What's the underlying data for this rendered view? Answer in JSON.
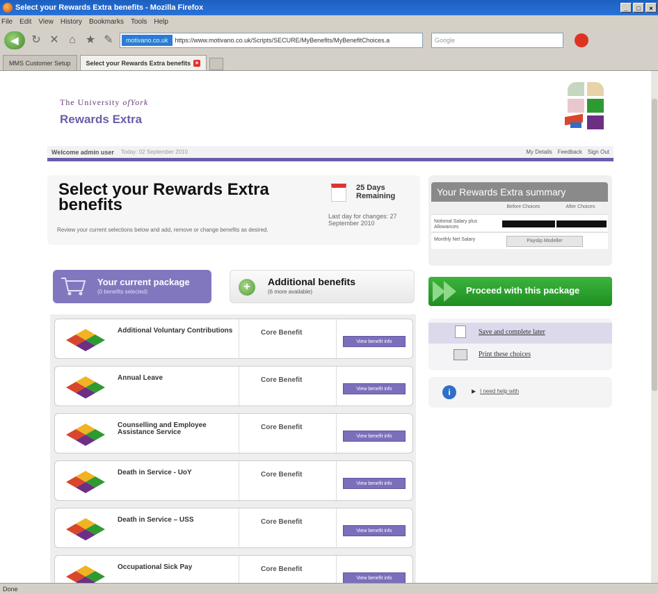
{
  "browser": {
    "window_title": "Select your Rewards Extra benefits - Mozilla Firefox",
    "menu": [
      "File",
      "Edit",
      "View",
      "History",
      "Bookmarks",
      "Tools",
      "Help"
    ],
    "site_identity": "motivano.co.uk",
    "url": "https://www.motivano.co.uk/Scripts/SECURE/MyBenefits/MyBenefitChoices.a",
    "search_placeholder": "Google",
    "tabs": [
      {
        "label": "MMS Customer Setup",
        "active": false
      },
      {
        "label": "Select your Rewards Extra benefits",
        "active": true
      }
    ],
    "status": "Done"
  },
  "header": {
    "university_prefix": "The University",
    "university_of": "of",
    "university_name": "York",
    "product": "Rewards Extra"
  },
  "welcome": {
    "user": "Welcome admin user",
    "date": "Today: 02 September 2010",
    "links": [
      "My Details",
      "Feedback",
      "Sign Out"
    ]
  },
  "select": {
    "title": "Select your Rewards Extra benefits",
    "description": "Review your current selections below and add, remove or change benefits as desired.",
    "days_count": "25 Days",
    "days_label": "Remaining",
    "last_day": "Last day for changes: 27 September 2010"
  },
  "summary": {
    "title": "Your Rewards Extra summary",
    "col_before": "Before Choices",
    "col_after": "After Choices",
    "rows": [
      {
        "label": "Notional Salary plus Allowances"
      },
      {
        "label": "Monthly Net Salary",
        "button": "Payslip Modeller"
      }
    ]
  },
  "package": {
    "current_title": "Your current package",
    "current_sub": "(0 benefits selected)",
    "additional_title": "Additional benefits",
    "additional_sub": "(6 more available)",
    "proceed": "Proceed with this package"
  },
  "benefits": [
    {
      "name": "Additional Voluntary Contributions",
      "type": "Core Benefit",
      "button": "View benefit info"
    },
    {
      "name": "Annual Leave",
      "type": "Core Benefit",
      "button": "View benefit info"
    },
    {
      "name": "Counselling and Employee Assistance Service",
      "type": "Core Benefit",
      "button": "View benefit info"
    },
    {
      "name": "Death in Service - UoY",
      "type": "Core Benefit",
      "button": "View benefit info"
    },
    {
      "name": "Death in Service – USS",
      "type": "Core Benefit",
      "button": "View benefit info"
    },
    {
      "name": "Occupational Sick Pay",
      "type": "Core Benefit",
      "button": "View benefit info"
    }
  ],
  "actions": {
    "save": "Save and complete later",
    "print": "Print these choices",
    "help": "I need help with"
  },
  "colors": {
    "brand_purple": "#6c5ca8",
    "current_tab": "#8177bf",
    "proceed_green": "#2aa02e"
  },
  "icons": [
    "firefox-icon",
    "back-arrow-icon",
    "reload-icon",
    "stop-icon",
    "home-icon",
    "calendar-icon",
    "cart-icon",
    "plus-icon",
    "double-arrow-icon",
    "save-disk-icon",
    "printer-icon",
    "info-icon",
    "benefit-leaf-icon"
  ]
}
